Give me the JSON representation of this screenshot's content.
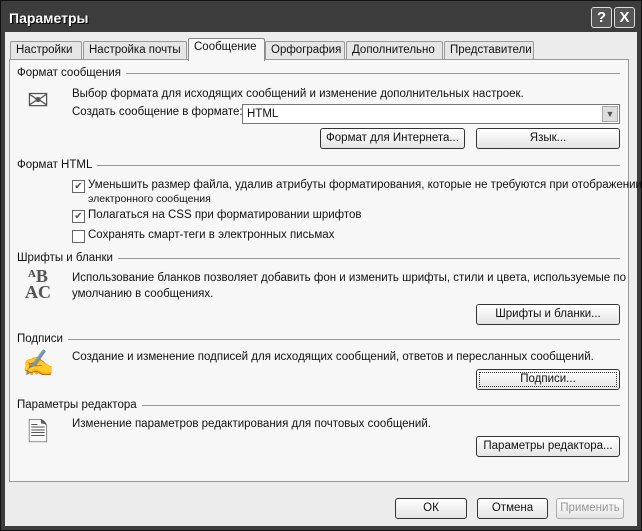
{
  "window": {
    "title": "Параметры",
    "help_label": "?",
    "close_label": "X"
  },
  "tabs": [
    {
      "label": "Настройки"
    },
    {
      "label": "Настройка почты"
    },
    {
      "label": "Сообщение",
      "selected": true
    },
    {
      "label": "Орфография"
    },
    {
      "label": "Дополнительно"
    },
    {
      "label": "Представители"
    }
  ],
  "message_format": {
    "heading": "Формат сообщения",
    "description": "Выбор формата для исходящих сообщений и изменение дополнительных настроек.",
    "compose_label": "Создать сообщение в формате:",
    "compose_value": "HTML",
    "internet_format_button": "Формат для Интернета...",
    "language_button": "Язык..."
  },
  "html_format": {
    "heading": "Формат HTML",
    "options": [
      {
        "label": "Уменьшить размер файла, удалив атрибуты форматирования, которые не требуются при отображении",
        "label2": "электронного сообщения",
        "checked": true
      },
      {
        "label": "Полагаться на CSS при форматировании шрифтов",
        "checked": true
      },
      {
        "label": "Сохранять смарт-теги в электронных письмах",
        "checked": false
      }
    ]
  },
  "stationery": {
    "heading": "Шрифты и бланки",
    "description1": "Использование бланков позволяет добавить фон и изменить шрифты, стили и цвета, используемые по",
    "description2": "умолчанию в сообщениях.",
    "button": "Шрифты и бланки..."
  },
  "signatures": {
    "heading": "Подписи",
    "description": "Создание и изменение подписей для исходящих сообщений, ответов и пересланных сообщений.",
    "button": "Подписи..."
  },
  "editor": {
    "heading": "Параметры редактора",
    "description": "Изменение параметров редактирования для почтовых сообщений.",
    "button": "Параметры редактора..."
  },
  "footer": {
    "ok": "ОК",
    "cancel": "Отмена",
    "apply": "Применить"
  }
}
